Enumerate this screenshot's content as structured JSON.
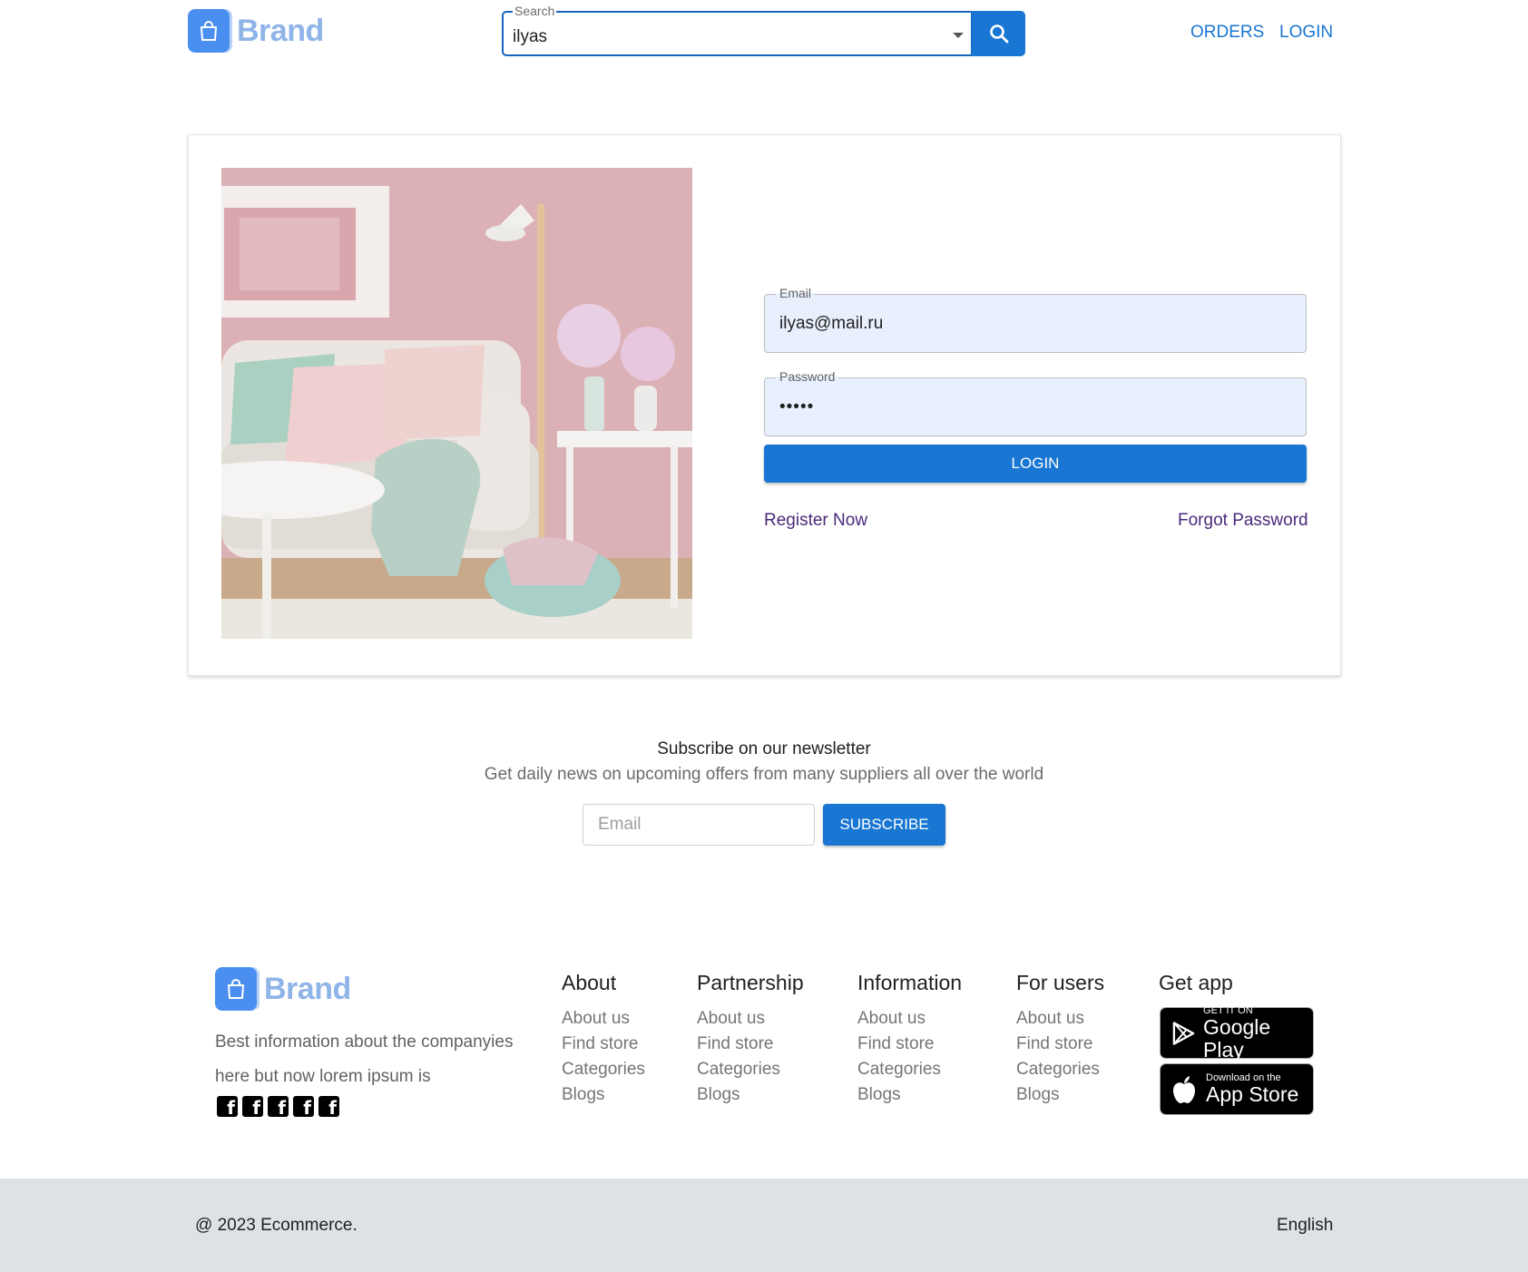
{
  "header": {
    "brand": "Brand",
    "search": {
      "label": "Search",
      "value": "ilyas"
    },
    "nav": {
      "orders": "ORDERS",
      "login": "LOGIN"
    }
  },
  "login_form": {
    "email_label": "Email",
    "email_value": "ilyas@mail.ru",
    "password_label": "Password",
    "password_value": "•••••",
    "login_button": "LOGIN",
    "register_link": "Register Now",
    "forgot_link": "Forgot Password"
  },
  "newsletter": {
    "title": "Subscribe on our newsletter",
    "subtitle": "Get daily news on upcoming offers from many suppliers all over the world",
    "email_placeholder": "Email",
    "button": "SUBSCRIBE"
  },
  "footer": {
    "brand": "Brand",
    "description": "Best information about the companyies here but now lorem ipsum is",
    "socials": [
      "facebook-icon",
      "facebook-icon",
      "facebook-icon",
      "facebook-icon",
      "facebook-icon"
    ],
    "columns": [
      {
        "title": "About",
        "links": [
          "About us",
          "Find store",
          "Categories",
          "Blogs"
        ]
      },
      {
        "title": "Partnership",
        "links": [
          "About us",
          "Find store",
          "Categories",
          "Blogs"
        ]
      },
      {
        "title": "Information",
        "links": [
          "About us",
          "Find store",
          "Categories",
          "Blogs"
        ]
      },
      {
        "title": "For users",
        "links": [
          "About us",
          "Find store",
          "Categories",
          "Blogs"
        ]
      }
    ],
    "get_app": {
      "title": "Get app",
      "google_small": "GET IT ON",
      "google_big": "Google Play",
      "apple_small": "Download on the",
      "apple_big": "App Store"
    },
    "copyright": "@ 2023 Ecommerce.",
    "language": "English"
  },
  "colors": {
    "primary": "#1976d2",
    "brand_badge": "#4a8ff0",
    "brand_text": "#8fb4e8",
    "field_fill": "#e8f0fe",
    "link_purple": "#4a2a7a",
    "bottom_bar": "#dee2e6"
  }
}
